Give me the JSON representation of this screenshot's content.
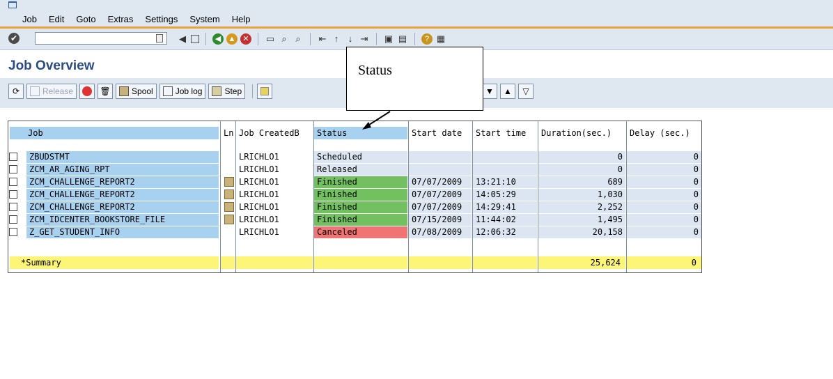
{
  "menu": [
    "Job",
    "Edit",
    "Goto",
    "Extras",
    "Settings",
    "System",
    "Help"
  ],
  "page_title": "Job Overview",
  "toolbar": {
    "release_label": "Release",
    "spool_label": "Spool",
    "joblog_label": "Job log",
    "step_label": "Step"
  },
  "callout": {
    "text": "Status"
  },
  "table": {
    "columns": [
      "Job",
      "Ln",
      "Job CreatedB",
      "Status",
      "Start date",
      "Start time",
      "Duration(sec.)",
      "Delay (sec.)"
    ],
    "rows": [
      {
        "job": "ZBUDSTMT",
        "ln": "",
        "created_by": "LRICHLO1",
        "status": "Scheduled",
        "start_date": "",
        "start_time": "",
        "duration": "0",
        "delay": "0",
        "status_color": "",
        "spool": false
      },
      {
        "job": "ZCM_AR_AGING_RPT",
        "ln": "",
        "created_by": "LRICHLO1",
        "status": "Released",
        "start_date": "",
        "start_time": "",
        "duration": "0",
        "delay": "0",
        "status_color": "",
        "spool": false
      },
      {
        "job": "ZCM_CHALLENGE_REPORT2",
        "ln": "",
        "created_by": "LRICHLO1",
        "status": "Finished",
        "start_date": "07/07/2009",
        "start_time": "13:21:10",
        "duration": "689",
        "delay": "0",
        "status_color": "#73c060",
        "spool": true
      },
      {
        "job": "ZCM_CHALLENGE_REPORT2",
        "ln": "",
        "created_by": "LRICHLO1",
        "status": "Finished",
        "start_date": "07/07/2009",
        "start_time": "14:05:29",
        "duration": "1,030",
        "delay": "0",
        "status_color": "#73c060",
        "spool": true
      },
      {
        "job": "ZCM_CHALLENGE_REPORT2",
        "ln": "",
        "created_by": "LRICHLO1",
        "status": "Finished",
        "start_date": "07/07/2009",
        "start_time": "14:29:41",
        "duration": "2,252",
        "delay": "0",
        "status_color": "#73c060",
        "spool": true
      },
      {
        "job": "ZCM_IDCENTER_BOOKSTORE_FILE",
        "ln": "",
        "created_by": "LRICHLO1",
        "status": "Finished",
        "start_date": "07/15/2009",
        "start_time": "11:44:02",
        "duration": "1,495",
        "delay": "0",
        "status_color": "#73c060",
        "spool": true
      },
      {
        "job": "Z_GET_STUDENT_INFO",
        "ln": "",
        "created_by": "LRICHLO1",
        "status": "Canceled",
        "start_date": "07/08/2009",
        "start_time": "12:06:32",
        "duration": "20,158",
        "delay": "0",
        "status_color": "#f07474",
        "spool": false
      }
    ],
    "summary": {
      "label": "*Summary",
      "duration": "25,624",
      "delay": "0"
    }
  },
  "colors": {
    "header_bg": "#a8d1f0",
    "job_col_bg": "#a8d1f0",
    "summary_bg": "#fcf577",
    "finished": "#73c060",
    "canceled": "#f07474",
    "title": "#2b4b82"
  }
}
